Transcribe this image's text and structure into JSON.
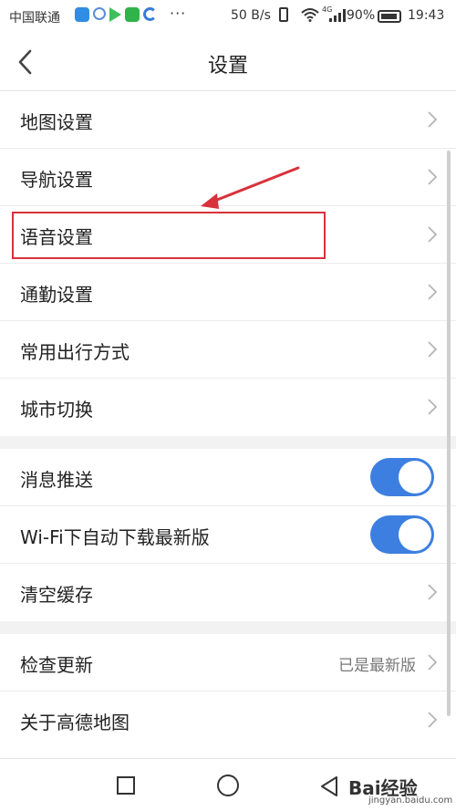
{
  "status_bar": {
    "carrier": "中国联通",
    "speed": "50 B/s",
    "network_type": "4G",
    "battery": "90%",
    "time": "19:43",
    "more_indicator": "···"
  },
  "header": {
    "title": "设置",
    "back_icon": "chevron-left-icon"
  },
  "groups": [
    {
      "items": [
        {
          "label": "地图设置"
        },
        {
          "label": "导航设置"
        },
        {
          "label": "语音设置"
        },
        {
          "label": "通勤设置"
        },
        {
          "label": "常用出行方式"
        },
        {
          "label": "城市切换"
        }
      ]
    },
    {
      "items": [
        {
          "label": "消息推送",
          "toggle_on": true
        },
        {
          "label": "Wi-Fi下自动下载最新版",
          "toggle_on": true
        },
        {
          "label": "清空缓存"
        }
      ]
    },
    {
      "items": [
        {
          "label": "检查更新",
          "value": "已是最新版"
        },
        {
          "label": "关于高德地图"
        }
      ]
    }
  ],
  "annotation": {
    "highlight_color": "#d8323c",
    "highlighted_item": "语音设置"
  },
  "watermark": {
    "brand": "Bai经验",
    "url": "jingyan.baidu.com"
  },
  "colors": {
    "toggle_on": "#3d7fe0",
    "section_gap": "#f2f2f2"
  }
}
